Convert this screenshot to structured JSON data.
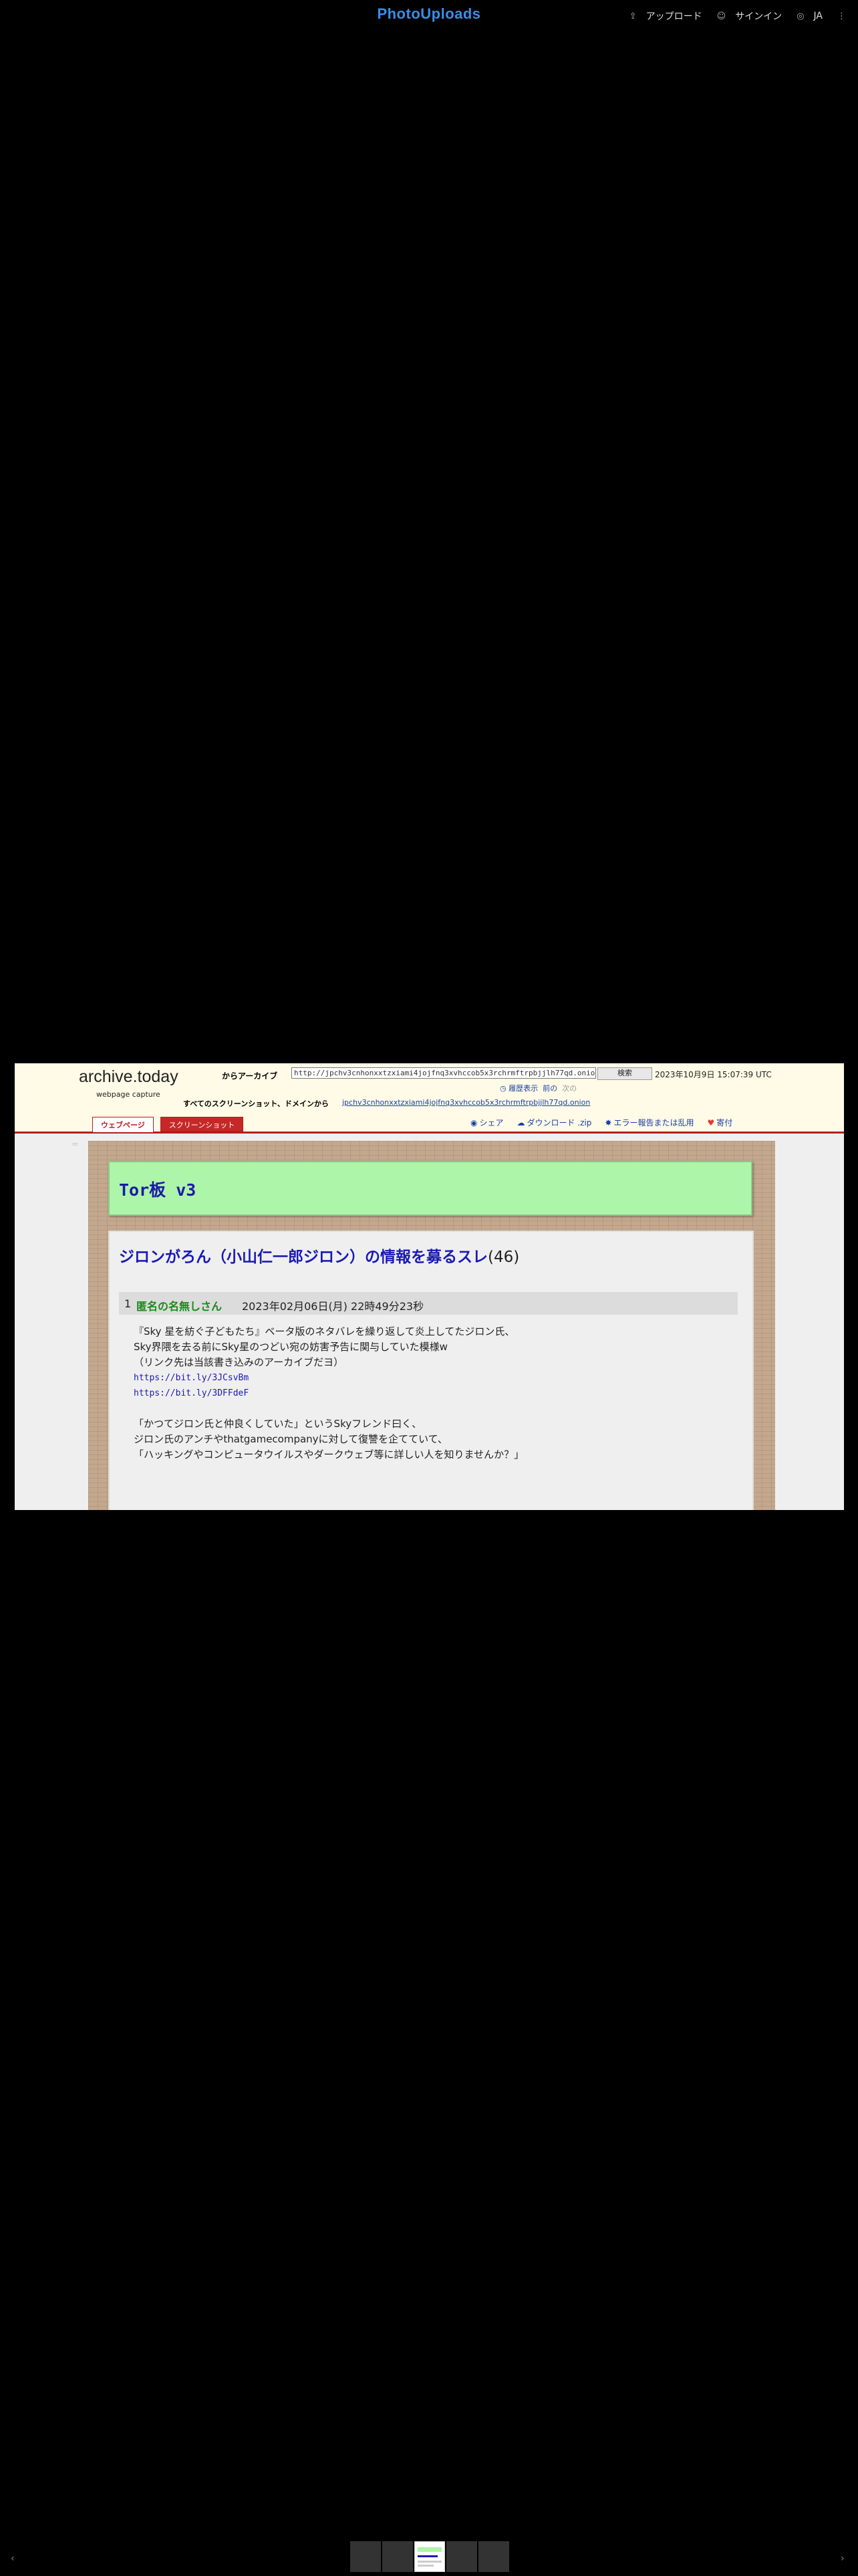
{
  "app": {
    "logo": "PhotoUploads",
    "nav": {
      "upload_label": "アップロード",
      "signin_label": "サインイン",
      "lang_label": "JA"
    }
  },
  "archive": {
    "logo": "archive.today",
    "subtitle": "webpage capture",
    "archive_from_label": "からアーカイブ",
    "url_value": "http://jpchv3cnhonxxtzxiami4jojfnq3xvhccob5x3rchrmftrpbjjlh77qd.onion",
    "search_button": "検索",
    "timestamp": "2023年10月9日 15:07:39 UTC",
    "history_label": "履歴表示",
    "prev_label": "前の",
    "next_label": "次の",
    "all_screenshots_label": "すべてのスクリーンショット、ドメインから",
    "domain_link": "jpchv3cnhonxxtzxiami4jojfnq3xvhccob5x3rchrmftrpbjjlh77qd.onion",
    "tabs": [
      {
        "label": "ウェブページ"
      },
      {
        "label": "スクリーンショット"
      }
    ],
    "actions": {
      "share": "シェア",
      "download": "ダウンロード .zip",
      "report": "エラー報告または乱用",
      "donate": "寄付"
    }
  },
  "page": {
    "board_title": "Tor板 v3",
    "thread_title": "ジロンがろん（小山仁一郎ジロン）の情報を募るスレ",
    "thread_count": "(46)",
    "post": {
      "number": "1",
      "name": "匿名の名無しさん",
      "date": "2023年02月06日(月) 22時49分23秒",
      "lines": [
        "『Sky 星を紡ぐ子どもたち』ベータ版のネタバレを繰り返して炎上してたジロン氏、",
        "Sky界隈を去る前にSky星のつどい宛の妨害予告に関与していた模様w",
        "（リンク先は当該書き込みのアーカイブだヨ）"
      ],
      "links": [
        "https://bit.ly/3JCsvBm",
        "https://bit.ly/3DFFdeF"
      ],
      "lines2": [
        "「かつてジロン氏と仲良くしていた」というSkyフレンド曰く、",
        "ジロン氏のアンチやthatgamecompanyに対して復讐を企てていて、",
        "「ハッキングやコンピュータウイルスやダークウェブ等に詳しい人を知りませんか？」"
      ]
    }
  }
}
